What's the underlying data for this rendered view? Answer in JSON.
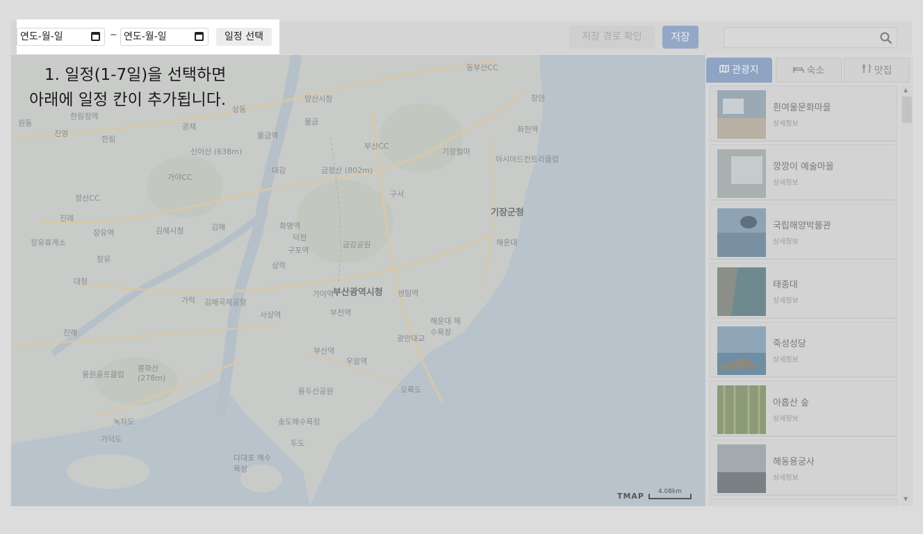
{
  "date_picker": {
    "start_placeholder": "연도-월-일",
    "separator": "~",
    "end_placeholder": "연도-월-일",
    "select_label": "일정 선택"
  },
  "toolbar": {
    "route_label": "저장 경로 확인",
    "save_label": "저장"
  },
  "search": {
    "placeholder": "",
    "icon": "search-icon"
  },
  "instruction": {
    "line1": "1. 일정(1-7일)을 선택하면",
    "line2": "아래에 일정 칸이 추가됩니다."
  },
  "map": {
    "labels": [
      "동부산CC",
      "양산시청",
      "물금",
      "부산CC",
      "기장철마",
      "아시아드컨트리클럽",
      "기장군청",
      "신어산 (638m)",
      "금정산 (802m)",
      "가야CC",
      "구서",
      "대감",
      "진례",
      "김해시청",
      "김해",
      "화명역",
      "덕천",
      "구포역",
      "금강공원",
      "해운대",
      "정산CC",
      "장유역",
      "장유휴게소",
      "장유",
      "삼락",
      "김해국제공항",
      "가락",
      "사상역",
      "가야역",
      "부산광역시청",
      "센텀역",
      "부전역",
      "해운대 해수욕장",
      "광안대교",
      "진해",
      "대청",
      "봉화산 (278m)",
      "용원골프클럽",
      "부산역",
      "우암역",
      "용두산공원",
      "오륙도",
      "송도해수욕장",
      "다대포 해수욕장",
      "두도",
      "녹차도",
      "가덕도",
      "한림",
      "한림정역",
      "진영",
      "광재",
      "상동",
      "물금역",
      "장안",
      "좌천역",
      "원동"
    ],
    "provider": "TMAP",
    "scale": "4.08km"
  },
  "tabs": [
    {
      "label": "관광지",
      "icon": "map-icon",
      "active": true
    },
    {
      "label": "숙소",
      "icon": "bed-icon",
      "active": false
    },
    {
      "label": "맛집",
      "icon": "utensils-icon",
      "active": false
    }
  ],
  "places": [
    {
      "name": "흰여울문화마을",
      "sub": "상세정보",
      "color": "#9aa9b3"
    },
    {
      "name": "깡깡이 예술마을",
      "sub": "상세정보",
      "color": "#a8b0b0"
    },
    {
      "name": "국립해양박물관",
      "sub": "상세정보",
      "color": "#7f97aa"
    },
    {
      "name": "태종대",
      "sub": "상세정보",
      "color": "#6e8a8e"
    },
    {
      "name": "죽성성당",
      "sub": "상세정보",
      "color": "#7d98ad"
    },
    {
      "name": "아홉산 숲",
      "sub": "상세정보",
      "color": "#8b9a77"
    },
    {
      "name": "해동용궁사",
      "sub": "상세정보",
      "color": "#8c9296"
    }
  ]
}
